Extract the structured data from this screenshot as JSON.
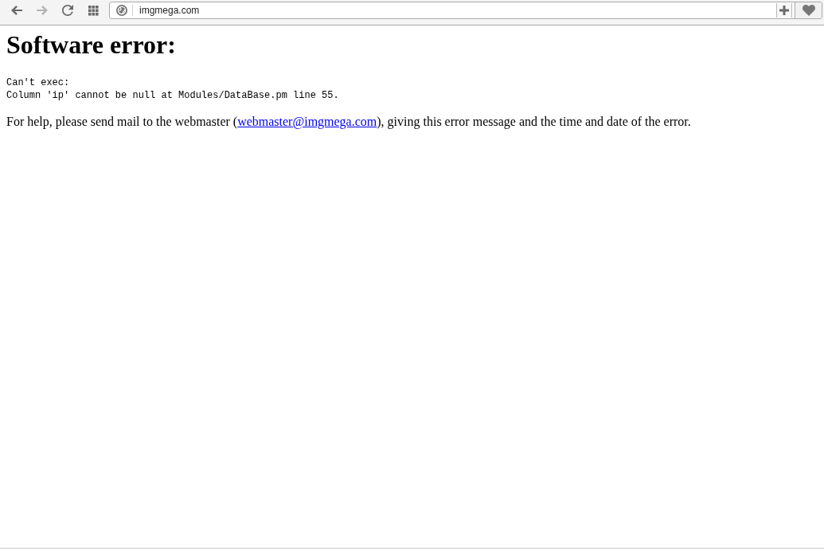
{
  "toolbar": {
    "nav_buttons": [
      {
        "kind": "back",
        "disabled": false
      },
      {
        "kind": "forward",
        "disabled": true
      },
      {
        "kind": "reload",
        "disabled": false
      },
      {
        "kind": "apps",
        "disabled": false
      }
    ],
    "address_bar": {
      "url": "imgmega.com"
    }
  },
  "page": {
    "title": "Software error:",
    "error_lines": [
      "Can't exec:",
      "Column 'ip' cannot be null at Modules/DataBase.pm line 55."
    ],
    "help": {
      "before": "For help, please send mail to the webmaster (",
      "link": "webmaster@imgmega.com",
      "after": "), giving this error message and the time and date of the error."
    }
  }
}
